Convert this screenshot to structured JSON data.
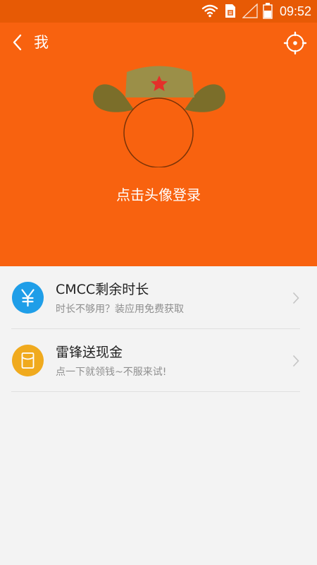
{
  "status_bar": {
    "time": "09:52",
    "icons": [
      "wifi-icon",
      "sim-card-icon",
      "signal-icon",
      "battery-icon"
    ]
  },
  "header": {
    "back_icon": "chevron-left-icon",
    "title": "我",
    "settings_icon": "settings-gear-icon",
    "login_text": "点击头像登录",
    "colors": {
      "background": "#f8620f",
      "status_bar": "#e75a05"
    }
  },
  "list": {
    "items": [
      {
        "icon": "yuan-icon",
        "icon_color": "#1f9ee8",
        "title": "CMCC剩余时长",
        "subtitle": "时长不够用？装应用免费获取"
      },
      {
        "icon": "red-envelope-icon",
        "icon_color": "#f0aa1e",
        "title": "雷锋送现金",
        "subtitle": "点一下就领钱~不服来试!"
      }
    ]
  }
}
